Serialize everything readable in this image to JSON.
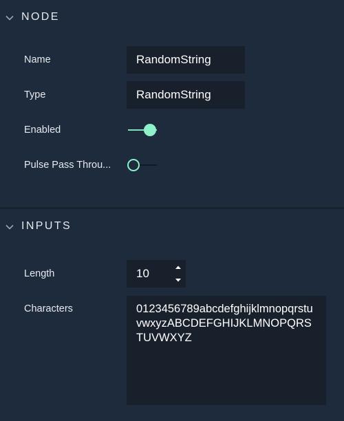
{
  "node_section": {
    "title": "NODE",
    "name_label": "Name",
    "name_value": "RandomString",
    "type_label": "Type",
    "type_value": "RandomString",
    "enabled_label": "Enabled",
    "enabled_on": true,
    "pulse_label": "Pulse Pass Throu...",
    "pulse_on": false
  },
  "inputs_section": {
    "title": "INPUTS",
    "length_label": "Length",
    "length_value": "10",
    "characters_label": "Characters",
    "characters_value": "0123456789abcdefghijklmnopqrstuvwxyzABCDEFGHIJKLMNOPQRSTUVWXYZ"
  },
  "icons": {
    "collapse": "chevron-down-icon",
    "increment": "caret-up-icon",
    "decrement": "caret-down-icon"
  },
  "colors": {
    "background": "#1e2b3c",
    "field": "#18202c",
    "accent": "#8ff0c9",
    "text": "#e6eaef"
  }
}
